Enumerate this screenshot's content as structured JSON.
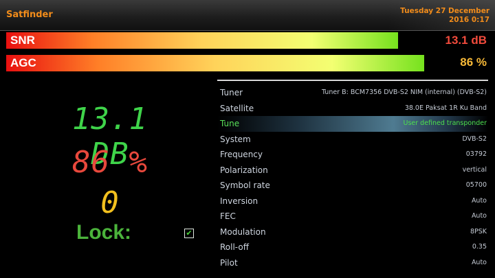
{
  "header": {
    "title": "Satfinder",
    "date": "Tuesday 27 December",
    "time": "2016  0:17"
  },
  "bars": {
    "snr": {
      "label": "SNR",
      "value": "13.1 dB",
      "fill_percent": 92,
      "color": "#f24b3c"
    },
    "agc": {
      "label": "AGC",
      "value": "86 %",
      "fill_percent": 98,
      "color": "#f7b938"
    }
  },
  "readouts": {
    "snr_big": {
      "text": "13.1 DB",
      "color": "#3fd44a"
    },
    "agc_big": {
      "text": "86 %",
      "color": "#e8483c"
    },
    "ber_big": {
      "text": "0",
      "color": "#f2c01e"
    },
    "lock_label": "Lock:",
    "lock_checked": true
  },
  "info": {
    "rows": [
      {
        "label": "Tuner",
        "value": "Tuner B: BCM7356 DVB-S2 NIM (internal) (DVB-S2)"
      },
      {
        "label": "Satellite",
        "value": "38.0E Paksat 1R Ku Band"
      },
      {
        "label": "Tune",
        "value": "User defined transponder",
        "selected": true
      },
      {
        "label": "System",
        "value": "DVB-S2"
      },
      {
        "label": "Frequency",
        "value": "03792"
      },
      {
        "label": "Polarization",
        "value": "vertical"
      },
      {
        "label": "Symbol rate",
        "value": "05700"
      },
      {
        "label": "Inversion",
        "value": "Auto"
      },
      {
        "label": "FEC",
        "value": "Auto"
      },
      {
        "label": "Modulation",
        "value": "8PSK"
      },
      {
        "label": "Roll-off",
        "value": "0.35"
      },
      {
        "label": "Pilot",
        "value": "Auto"
      }
    ]
  }
}
